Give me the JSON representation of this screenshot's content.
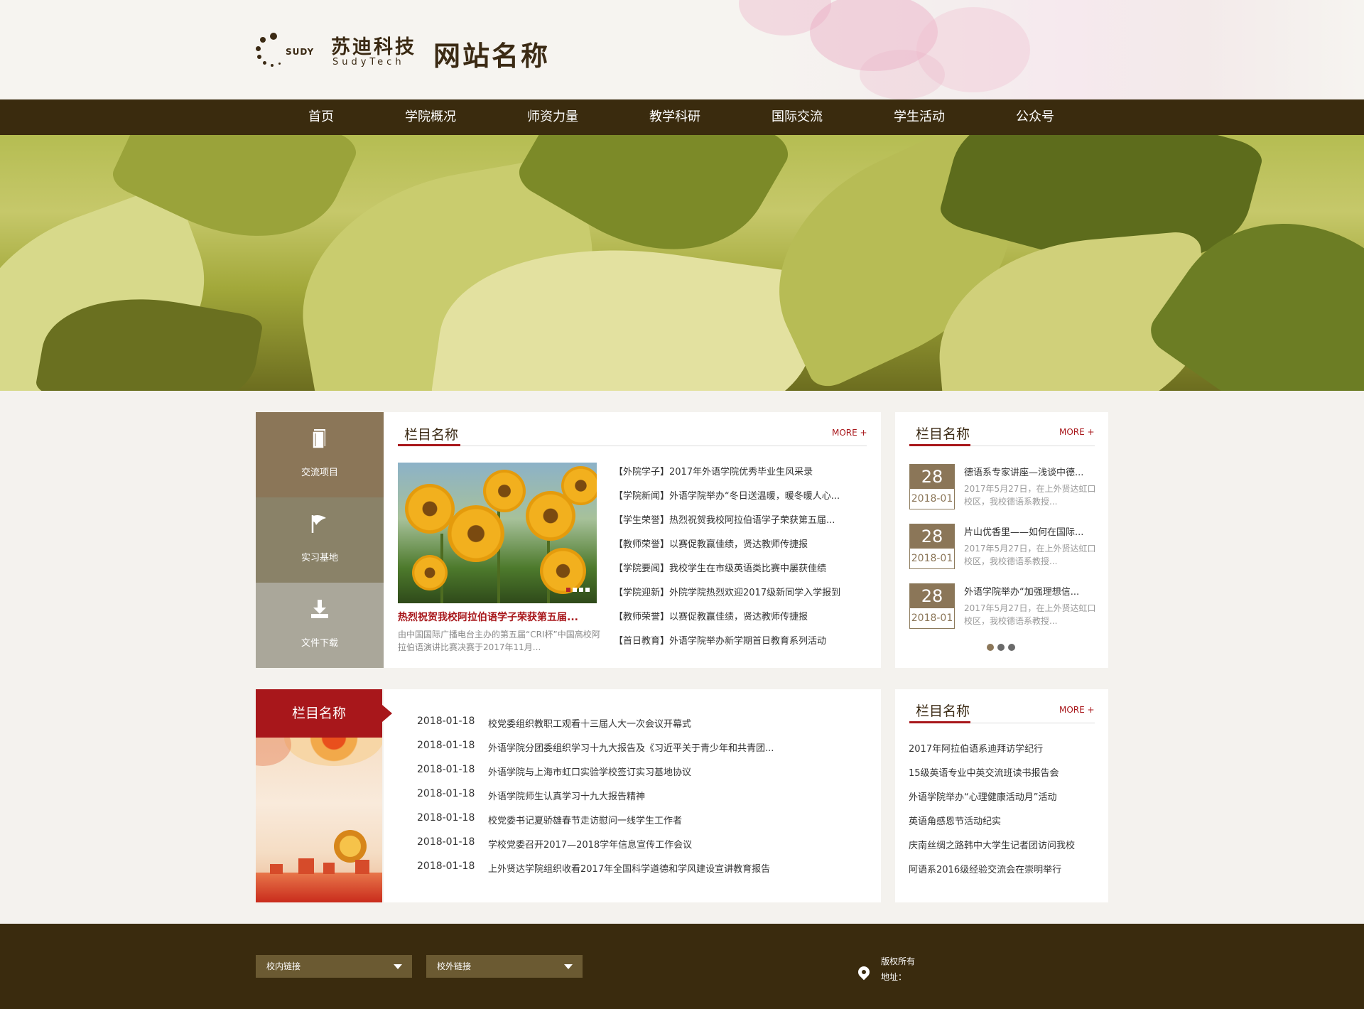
{
  "header": {
    "logo_sudy": "SUDY",
    "logo_cn": "苏迪科技",
    "logo_en": "SudyTech",
    "site_name": "网站名称"
  },
  "nav": {
    "items": [
      "首页",
      "学院概况",
      "师资力量",
      "教学科研",
      "国际交流",
      "学生活动",
      "公众号"
    ]
  },
  "quick_links": [
    {
      "label": "交流项目",
      "icon": "book-icon",
      "color": "#8b7658"
    },
    {
      "label": "实习基地",
      "icon": "flag-icon",
      "color": "#8a8268"
    },
    {
      "label": "文件下载",
      "icon": "download-icon",
      "color": "#aaa79a"
    }
  ],
  "news": {
    "title": "栏目名称",
    "more": "MORE +",
    "feature_title": "热烈祝贺我校阿拉伯语学子荣获第五届...",
    "feature_desc": "由中国国际广播电台主办的第五届“CRI杯”中国高校阿拉伯语演讲比赛决赛于2017年11月...",
    "items": [
      "【外院学子】2017年外语学院优秀毕业生风采录",
      "【学院新闻】外语学院举办“冬日送温暖，暖冬暖人心...",
      "【学生荣誉】热烈祝贺我校阿拉伯语学子荣获第五届...",
      "【教师荣誉】以赛促教赢佳绩，贤达教师传捷报",
      "【学院要闻】我校学生在市级英语类比赛中屡获佳绩",
      "【学院迎新】外院学院热烈欢迎2017级新同学入学报到",
      "【教师荣誉】以赛促教赢佳绩，贤达教师传捷报",
      "【首日教育】外语学院举办新学期首日教育系列活动"
    ]
  },
  "events": {
    "title": "栏目名称",
    "more": "MORE +",
    "items": [
      {
        "day": "28",
        "ym": "2018-01",
        "title": "德语系专家讲座—浅谈中德...",
        "desc": "2017年5月27日，在上外贤达虹口校区，我校德语系教授..."
      },
      {
        "day": "28",
        "ym": "2018-01",
        "title": "片山优香里——如何在国际...",
        "desc": "2017年5月27日，在上外贤达虹口校区，我校德语系教授..."
      },
      {
        "day": "28",
        "ym": "2018-01",
        "title": "外语学院举办“加强理想信...",
        "desc": "2017年5月27日，在上外贤达虹口校区，我校德语系教授..."
      }
    ]
  },
  "notices": {
    "title": "栏目名称",
    "items": [
      {
        "date": "2018-01-18",
        "title": "校党委组织教职工观看十三届人大一次会议开幕式"
      },
      {
        "date": "2018-01-18",
        "title": "外语学院分团委组织学习十九大报告及《习近平关于青少年和共青团..."
      },
      {
        "date": "2018-01-18",
        "title": "外语学院与上海市虹口实验学校签订实习基地协议"
      },
      {
        "date": "2018-01-18",
        "title": "外语学院师生认真学习十九大报告精神"
      },
      {
        "date": "2018-01-18",
        "title": "校党委书记夏骄雄春节走访慰问一线学生工作者"
      },
      {
        "date": "2018-01-18",
        "title": "学校党委召开2017—2018学年信息宣传工作会议"
      },
      {
        "date": "2018-01-18",
        "title": "上外贤达学院组织收看2017年全国科学道德和学风建设宣讲教育报告"
      }
    ]
  },
  "links": {
    "title": "栏目名称",
    "more": "MORE +",
    "items": [
      "2017年阿拉伯语系迪拜访学纪行",
      "15级英语专业中英交流班读书报告会",
      "外语学院举办“心理健康活动月”活动",
      "英语角感恩节活动纪实",
      "庆南丝绸之路韩中大学生记者团访问我校",
      "阿语系2016级经验交流会在崇明举行"
    ]
  },
  "footer": {
    "select_internal": "校内链接",
    "select_external": "校外链接",
    "copyright": "版权所有",
    "address": "地址："
  },
  "colors": {
    "brand_dark": "#3a2b0e",
    "accent_red": "#a8171b",
    "date_brown": "#8b7658"
  }
}
